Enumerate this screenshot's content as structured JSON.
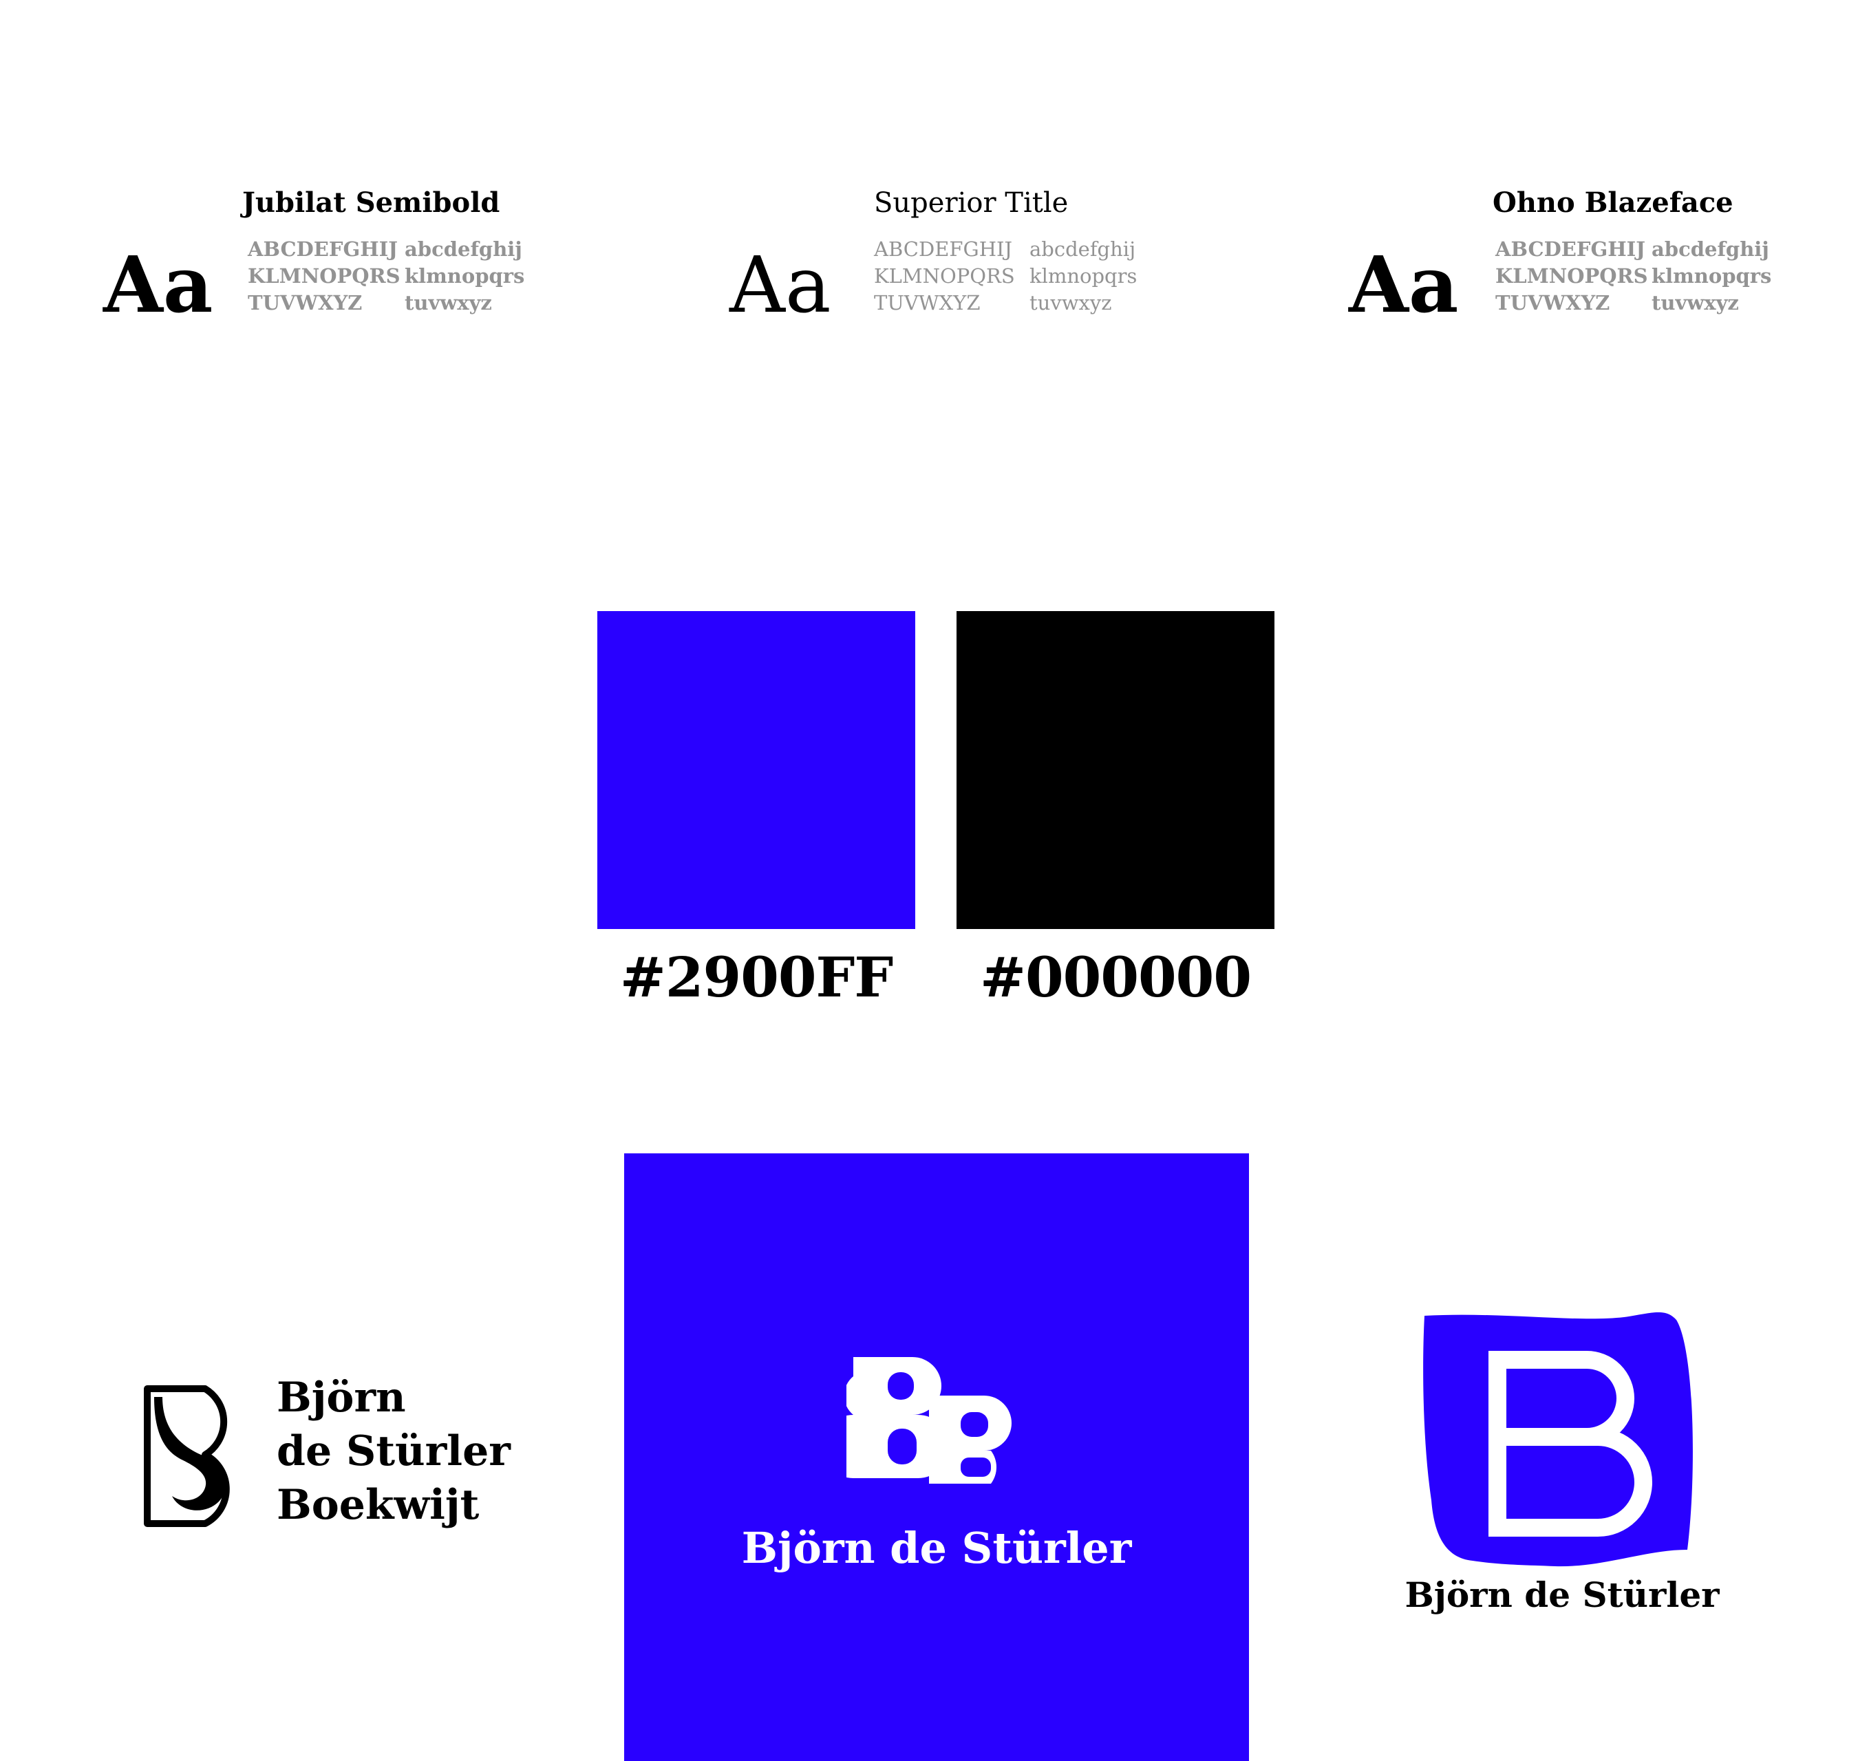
{
  "fonts": [
    {
      "name": "Jubilat Semibold",
      "sample": "Aa",
      "upper": [
        "ABCDEFGHIJ",
        "KLMNOPQRS",
        "TUVWXYZ"
      ],
      "lower": [
        "abcdefghij",
        "klmnopqrs",
        "tuvwxyz"
      ]
    },
    {
      "name": "Superior Title",
      "sample": "Aa",
      "upper": [
        "ABCDEFGHIJ",
        "KLMNOPQRS",
        "TUVWXYZ"
      ],
      "lower": [
        "abcdefghij",
        "klmnopqrs",
        "tuvwxyz"
      ]
    },
    {
      "name": "Ohno Blazeface",
      "sample": "Aa",
      "upper": [
        "ABCDEFGHIJ",
        "KLMNOPQRS",
        "TUVWXYZ"
      ],
      "lower": [
        "abcdefghij",
        "klmnopqrs",
        "tuvwxyz"
      ]
    }
  ],
  "palette": [
    {
      "label": "#2900FF",
      "color": "#2900FF"
    },
    {
      "label": "#000000",
      "color": "#000000"
    }
  ],
  "logos": {
    "left": {
      "lines": [
        "Björn",
        "de Stürler",
        "Boekwijt"
      ],
      "icon": "s-monogram-icon"
    },
    "center": {
      "text": "Björn de Stürler",
      "icon": "bb-monogram-icon"
    },
    "right": {
      "text": "Björn de Stürler",
      "icon": "b-monogram-icon"
    }
  },
  "colors": {
    "brand_blue": "#2900FF",
    "black": "#000000",
    "glyph_gray": "#939393",
    "white": "#FFFFFF"
  }
}
